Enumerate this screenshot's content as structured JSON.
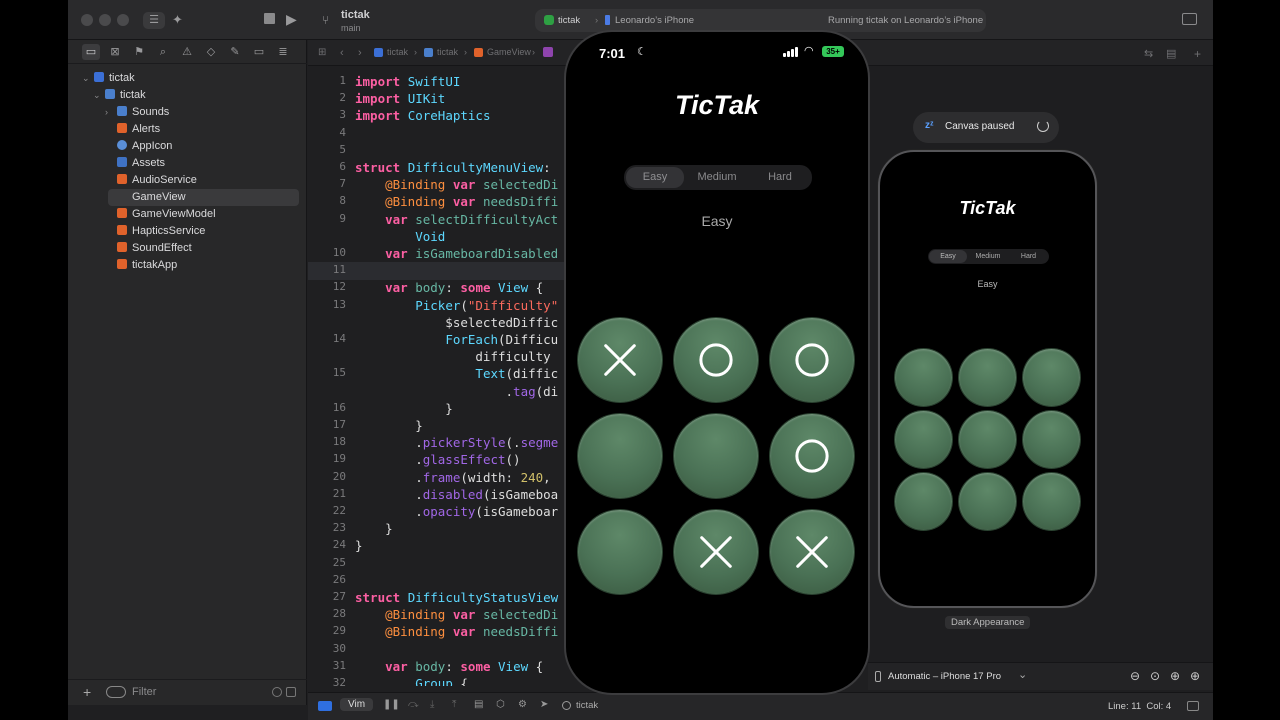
{
  "toolbar": {
    "project_name": "tictak",
    "branch": "main",
    "scheme": "tictak",
    "destination": "Leonardo’s iPhone",
    "status": "Running tictak on Leonardo’s iPhone"
  },
  "navigator": {
    "root": "tictak",
    "group": "tictak",
    "items": [
      "Sounds",
      "Alerts",
      "AppIcon",
      "Assets",
      "AudioService",
      "GameView",
      "GameViewModel",
      "HapticsService",
      "SoundEffect",
      "tictakApp"
    ],
    "selected": "GameView",
    "filter_placeholder": "Filter"
  },
  "jumpbar": [
    "tictak",
    "tictak",
    "GameView"
  ],
  "editor": {
    "line_numbers": [
      "1",
      "2",
      "3",
      "4",
      "5",
      "6",
      "7",
      "8",
      "9",
      "",
      "10",
      "11",
      "12",
      "13",
      "",
      "14",
      "",
      "15",
      "",
      "16",
      "17",
      "18",
      "19",
      "20",
      "21",
      "22",
      "23",
      "24",
      "25",
      "26",
      "27",
      "28",
      "29",
      "30",
      "31",
      "32"
    ],
    "lines": [
      "import SwiftUI",
      "import UIKit",
      "import CoreHaptics",
      "",
      "",
      "struct DifficultyMenuView:",
      "    @Binding var selectedDi",
      "    @Binding var needsDiffi",
      "    var selectDifficultyAct",
      "        Void",
      "    var isGameboardDisabled",
      "",
      "    var body: some View {",
      "        Picker(\"Difficulty\"",
      "            $selectedDiffic",
      "            ForEach(Difficu",
      "                difficulty",
      "                Text(diffic",
      "                    .tag(di",
      "            }",
      "        }",
      "        .pickerStyle(.segme",
      "        .glassEffect()",
      "        .frame(width: 240,",
      "        .disabled(isGameboa",
      "        .opacity(isGameboar",
      "    }",
      "}",
      "",
      "",
      "struct DifficultyStatusView",
      "    @Binding var selectedDi",
      "    @Binding var needsDiffi",
      "",
      "    var body: some View {",
      "        Group {"
    ]
  },
  "simulator": {
    "time": "7:01",
    "battery": "35+",
    "title": "TicTak",
    "segments": [
      "Easy",
      "Medium",
      "Hard"
    ],
    "selected_segment": 0,
    "difficulty_label": "Easy",
    "board": [
      "X",
      "O",
      "O",
      "",
      "",
      "O",
      "",
      "X",
      "X"
    ]
  },
  "canvas": {
    "paused_label": "Canvas paused",
    "preview_title": "TicTak",
    "preview_segments": [
      "Easy",
      "Medium",
      "Hard"
    ],
    "preview_difficulty": "Easy",
    "appearance_label": "Dark Appearance",
    "device_label": "Automatic – iPhone 17 Pro"
  },
  "statusbar": {
    "mode": "Vim",
    "target": "tictak",
    "position": "Line: 11  Col: 4"
  },
  "colors": {
    "accent": "#2f6fe0",
    "cell": "#4a7155",
    "keyword": "#fc5fa3"
  }
}
